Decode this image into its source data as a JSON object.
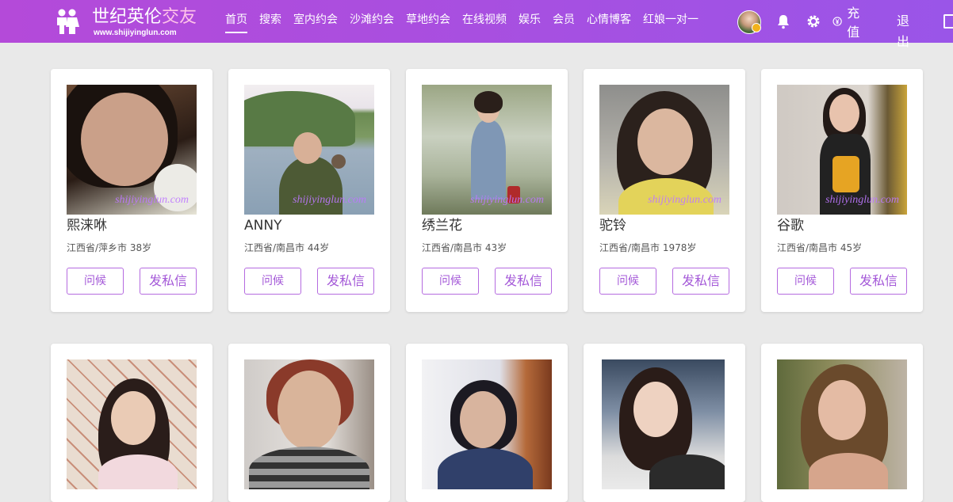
{
  "header": {
    "logo_name_main": "世纪英伦",
    "logo_name_accent": "交友",
    "logo_url": "www.shijiyinglun.com",
    "nav": [
      "首页",
      "搜索",
      "室内约会",
      "沙滩约会",
      "草地约会",
      "在线视频",
      "娱乐",
      "会员",
      "心情博客",
      "红娘一对一"
    ],
    "recharge": "充值",
    "logout": "退出",
    "icons": [
      "user-avatar",
      "bell-icon",
      "gear-icon",
      "yuan-icon",
      "device-icon"
    ]
  },
  "colors": {
    "header_gradient_start": "#b44ad9",
    "header_gradient_end": "#9a55e8",
    "button_border": "#b56be0",
    "button_text": "#a459d8",
    "watermark": "#be78ff"
  },
  "profiles": [
    {
      "name": "熙涞咻",
      "location": "江西省/萍乡市",
      "age": "38岁",
      "watermark": "shijiyinglun.com",
      "greet": "问候",
      "message": "发私信"
    },
    {
      "name": "ANNY",
      "location": "江西省/南昌市",
      "age": "44岁",
      "watermark": "shijiyinglun.com",
      "greet": "问候",
      "message": "发私信"
    },
    {
      "name": "绣兰花",
      "location": "江西省/南昌市",
      "age": "43岁",
      "watermark": "shijiyinglun.com",
      "greet": "问候",
      "message": "发私信"
    },
    {
      "name": "驼铃",
      "location": "江西省/南昌市",
      "age": "1978岁",
      "watermark": "shijiyinglun.com",
      "greet": "问候",
      "message": "发私信"
    },
    {
      "name": "谷歌",
      "location": "江西省/南昌市",
      "age": "45岁",
      "watermark": "shijiyinglun.com",
      "greet": "问候",
      "message": "发私信"
    }
  ]
}
